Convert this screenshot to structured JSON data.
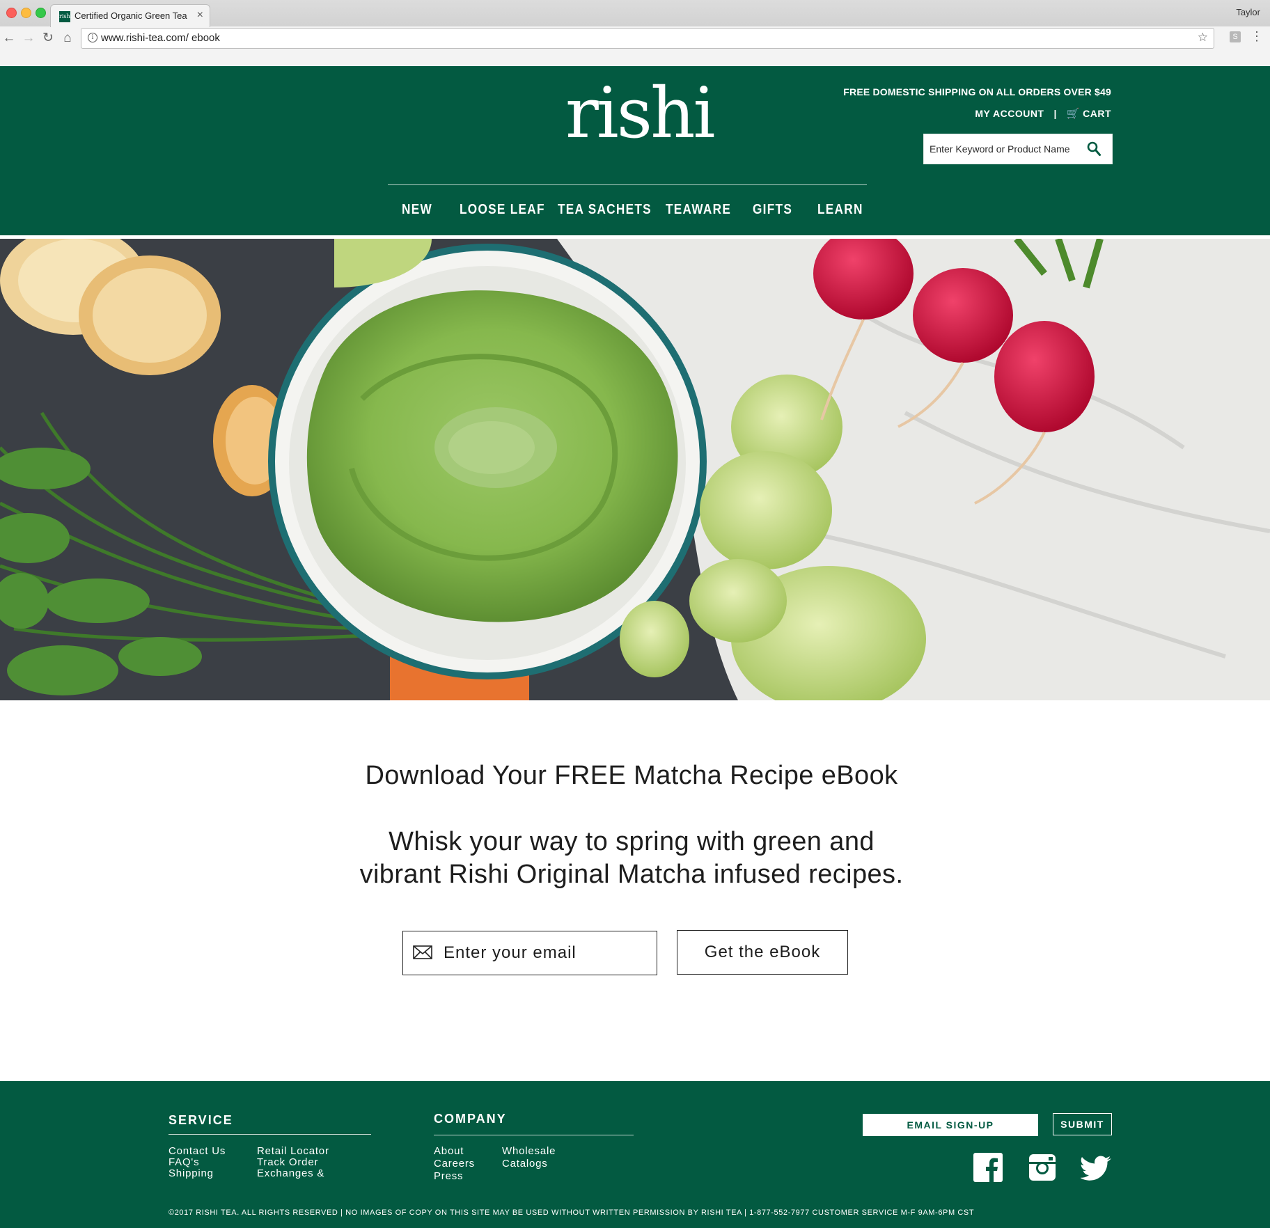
{
  "browser": {
    "tab_title": "Certified Organic Green Tea |",
    "tab_close": "×",
    "favicon_text": "rishi",
    "profile_name": "Taylor",
    "url": "www.rishi-tea.com/ ebook"
  },
  "header": {
    "logo": "rishi",
    "promo": "FREE DOMESTIC SHIPPING ON ALL ORDERS OVER $49",
    "my_account": "MY ACCOUNT",
    "separator": "|",
    "cart": "CART",
    "search_placeholder": "Enter Keyword or Product Name"
  },
  "nav": [
    "NEW",
    "LOOSE LEAF",
    "TEA SACHETS",
    "TEAWARE",
    "GIFTS",
    "LEARN"
  ],
  "hero_image": "Bowl of green matcha dip with crackers, carrots, romanesco and radishes",
  "content": {
    "headline": "Download Your FREE Matcha Recipe eBook",
    "subhead_line1": "Whisk your way to spring with green and",
    "subhead_line2": "vibrant Rishi Original Matcha infused recipes.",
    "email_placeholder": "Enter your email",
    "cta": "Get the eBook"
  },
  "footer": {
    "service_heading": "SERVICE",
    "service_col1": [
      "Contact Us",
      "FAQ's",
      "Shipping"
    ],
    "service_col2": [
      "Retail Locator",
      "Track Order",
      "Exchanges &"
    ],
    "company_heading": "COMPANY",
    "company_col1": [
      "About",
      "Careers",
      "Press"
    ],
    "company_col2": [
      "Wholesale",
      "Catalogs"
    ],
    "signup_placeholder": "EMAIL SIGN-UP",
    "submit": "SUBMIT",
    "legal": "©2017 RISHI TEA. ALL RIGHTS RESERVED  |  NO IMAGES OF COPY ON THIS SITE MAY BE USED WITHOUT WRITTEN PERMISSION BY RISHI TEA  |  1-877-552-7977 CUSTOMER SERVICE M-F 9AM-6PM CST"
  },
  "colors": {
    "brand_green": "#035a41",
    "text_dark": "#1d1d1d",
    "white": "#ffffff"
  }
}
